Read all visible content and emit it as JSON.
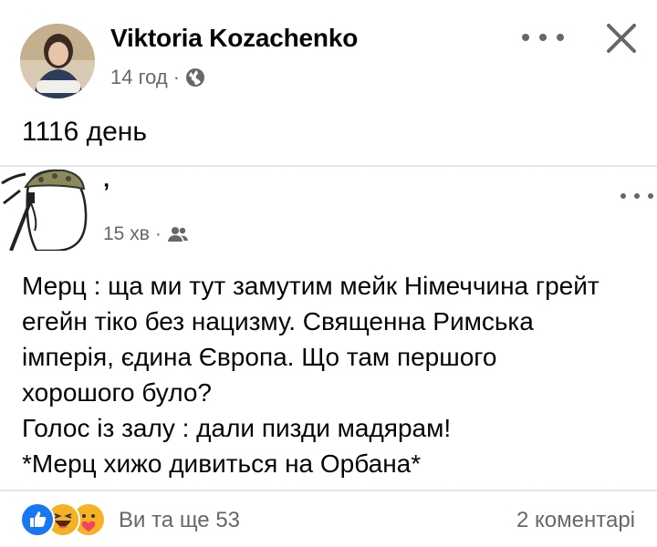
{
  "post": {
    "author": "Viktoria Kozachenko",
    "time": "14 год",
    "separator": "·",
    "text": "1116 день",
    "avatar_icon": "profile-photo",
    "privacy_icon": "globe-icon"
  },
  "shared": {
    "author": "ʼ",
    "time": "15 хв",
    "separator": "·",
    "privacy_icon": "friends-icon",
    "lines": [
      "Мерц : ща ми тут замутим мейк Німеччина грейт",
      "егейн тіко без нацизму. Священна Римська",
      "імперія, єдина Європа. Що там першого",
      "хорошого було?",
      "Голос із залу : дали пизди мадярам!",
      "*Мерц хижо дивиться на Орбана*"
    ]
  },
  "footer": {
    "reactions_text": "Ви та ще 53",
    "comments_text": "2 коментарі",
    "reaction_icons": [
      "like-icon",
      "haha-icon",
      "care-icon"
    ]
  },
  "colors": {
    "text_primary": "#050505",
    "text_secondary": "#65676b",
    "divider": "#e4e6eb",
    "like_blue": "#1877f2",
    "haha_yellow": "#f7b125"
  }
}
